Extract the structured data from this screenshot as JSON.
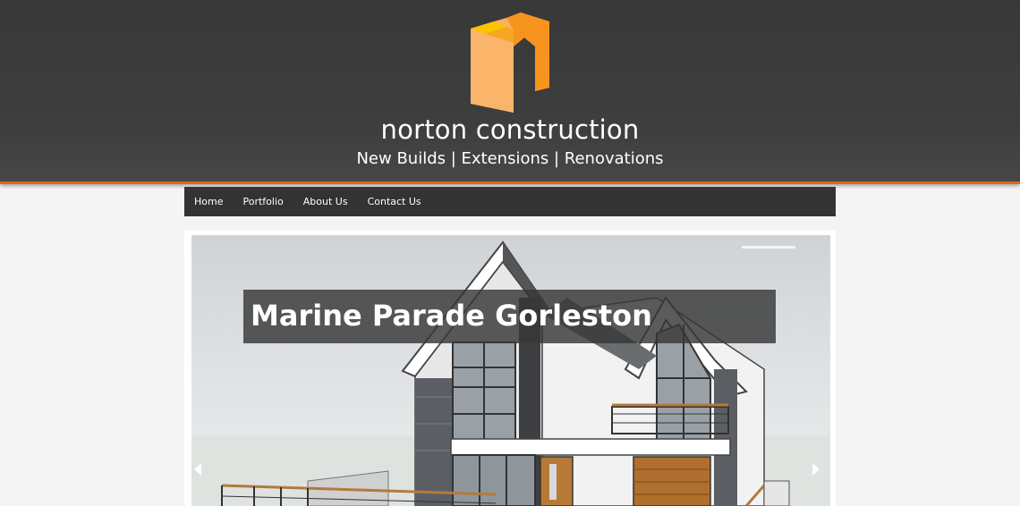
{
  "header": {
    "brand_name": "norton construction",
    "tagline": "New Builds | Extensions | Renovations",
    "logo_icon": "orange-n-block-logo",
    "accent_color": "#e0661e"
  },
  "nav": {
    "items": [
      {
        "label": "Home"
      },
      {
        "label": "Portfolio"
      },
      {
        "label": "About Us"
      },
      {
        "label": "Contact Us"
      }
    ]
  },
  "slider": {
    "caption": "Marine Parade Gorleston",
    "prev_icon": "chevron-left-icon",
    "next_icon": "chevron-right-icon",
    "image_subject": "architectural-house-render"
  }
}
